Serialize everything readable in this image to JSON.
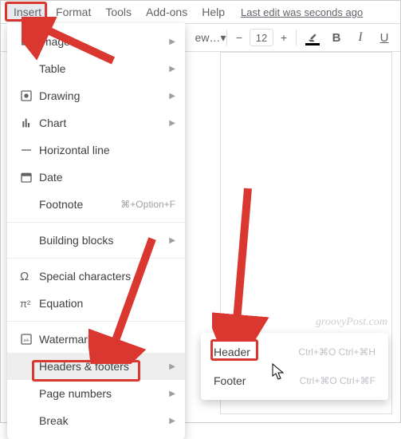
{
  "menubar": {
    "items": [
      "Insert",
      "Format",
      "Tools",
      "Add-ons",
      "Help"
    ],
    "lastedit": "Last edit was seconds ago"
  },
  "toolbar": {
    "style_text": "ew…",
    "font_size": "12",
    "bold": "B",
    "italic": "I",
    "underline": "U"
  },
  "insert_menu": {
    "items": [
      {
        "label": "Image",
        "icon": "image-icon",
        "submenu": true
      },
      {
        "label": "Table",
        "icon": "",
        "submenu": true
      },
      {
        "label": "Drawing",
        "icon": "drawing-icon",
        "submenu": true
      },
      {
        "label": "Chart",
        "icon": "chart-icon",
        "submenu": true
      },
      {
        "label": "Horizontal line",
        "icon": "line-icon",
        "submenu": false
      },
      {
        "label": "Date",
        "icon": "date-icon",
        "submenu": false
      },
      {
        "label": "Footnote",
        "icon": "",
        "shortcut": "⌘+Option+F",
        "submenu": false
      },
      {
        "separator": true
      },
      {
        "label": "Building blocks",
        "icon": "",
        "submenu": true
      },
      {
        "separator": true
      },
      {
        "label": "Special characters",
        "icon": "omega-icon",
        "submenu": false
      },
      {
        "label": "Equation",
        "icon": "pi-icon",
        "submenu": false
      },
      {
        "separator": true
      },
      {
        "label": "Watermark",
        "icon": "watermark-icon",
        "submenu": false
      },
      {
        "label": "Headers & footers",
        "icon": "",
        "submenu": true,
        "highlighted": true
      },
      {
        "label": "Page numbers",
        "icon": "",
        "submenu": true
      },
      {
        "label": "Break",
        "icon": "",
        "submenu": true
      }
    ]
  },
  "submenu": {
    "header": {
      "label": "Header",
      "shortcut": "Ctrl+⌘O Ctrl+⌘H"
    },
    "footer": {
      "label": "Footer",
      "shortcut": "Ctrl+⌘O Ctrl+⌘F"
    }
  },
  "watermark": "groovyPost.com"
}
